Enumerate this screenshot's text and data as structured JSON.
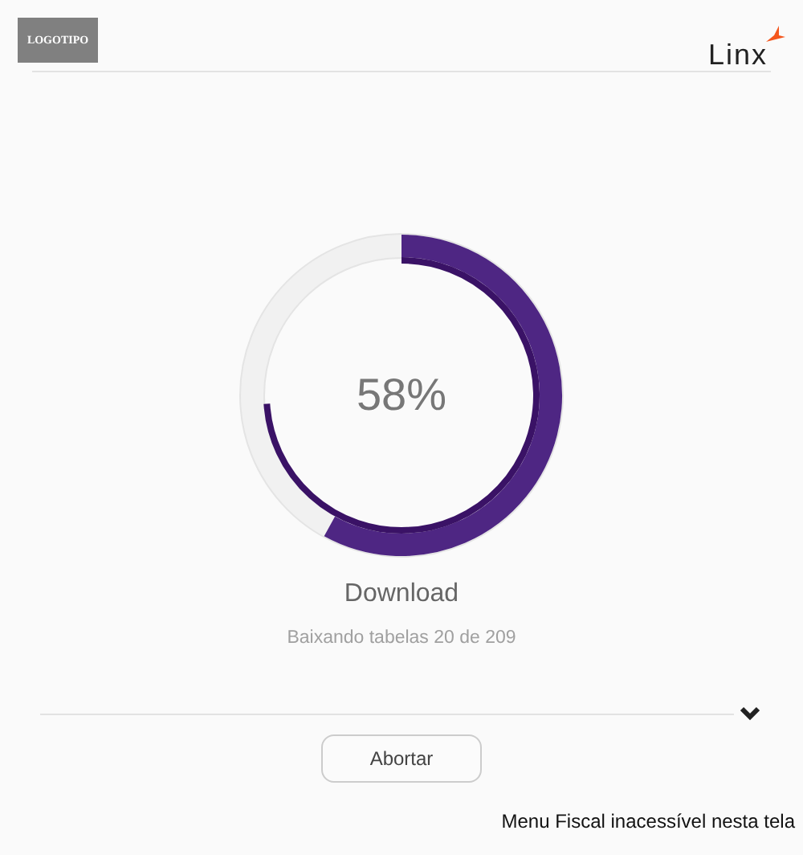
{
  "header": {
    "logo": "LOGOTIPO",
    "brand": "Linx"
  },
  "progress": {
    "reading": "58%"
  },
  "title": "Download",
  "status": "Baixando tabelas 20 de 209",
  "details": {
    "expanded": false
  },
  "buttons": [
    "Abortar"
  ],
  "footer": "Menu Fiscal inacessível nesta tela"
}
